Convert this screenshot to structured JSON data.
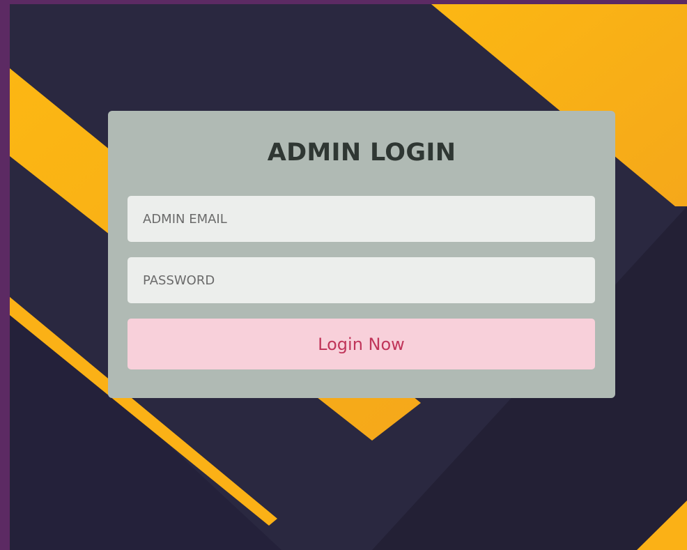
{
  "login": {
    "title": "ADMIN LOGIN",
    "email_placeholder": "ADMIN EMAIL",
    "password_placeholder": "PASSWORD",
    "button_label": "Login Now"
  },
  "colors": {
    "background_dark": "#2a2840",
    "accent_yellow": "#fbb116",
    "page_border": "#5c2a63",
    "card": "#b0bab4",
    "button_bg": "#f8d0da",
    "button_text": "#c0355a"
  }
}
